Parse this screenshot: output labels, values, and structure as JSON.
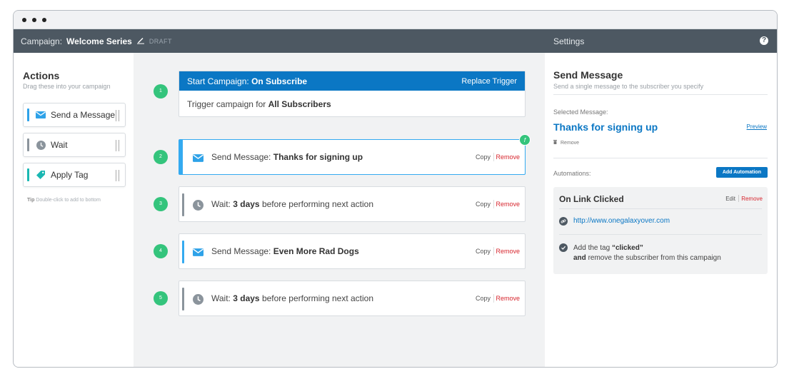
{
  "header": {
    "campaign_label": "Campaign:",
    "campaign_name": "Welcome Series",
    "status": "DRAFT",
    "settings_label": "Settings",
    "help": "?"
  },
  "actions": {
    "title": "Actions",
    "subtitle": "Drag these into your campaign",
    "items": [
      {
        "label": "Send a Message",
        "icon": "envelope-icon",
        "color": "#2ea2e8"
      },
      {
        "label": "Wait",
        "icon": "clock-icon",
        "color": "#8b949c"
      },
      {
        "label": "Apply Tag",
        "icon": "tag-icon",
        "color": "#1ab7b2"
      }
    ],
    "tip_label": "Tip",
    "tip_text": "Double-click to add to bottom"
  },
  "workflow": {
    "trigger": {
      "step": "1",
      "title_prefix": "Start Campaign:",
      "title_value": "On Subscribe",
      "replace_label": "Replace Trigger",
      "body_prefix": "Trigger campaign for",
      "body_value": "All Subscribers"
    },
    "steps": [
      {
        "step": "2",
        "type": "message",
        "prefix": "Send Message:",
        "value": "Thanks for signing up",
        "suffix": ""
      },
      {
        "step": "3",
        "type": "wait",
        "prefix": "Wait:",
        "value": "3 days",
        "suffix": "before performing next action"
      },
      {
        "step": "4",
        "type": "message",
        "prefix": "Send Message:",
        "value": "Even More Rad Dogs",
        "suffix": ""
      },
      {
        "step": "5",
        "type": "wait",
        "prefix": "Wait:",
        "value": "3 days",
        "suffix": "before performing next action"
      }
    ],
    "copy_label": "Copy",
    "remove_label": "Remove",
    "badge": "f"
  },
  "settings": {
    "title": "Send Message",
    "subtitle": "Send a single message to the subscriber you specify",
    "selected_label": "Selected Message:",
    "selected_message": "Thanks for signing up",
    "preview_label": "Preview",
    "remove_label": "Remove",
    "automations_label": "Automations:",
    "add_button": "Add Automation",
    "automation": {
      "title": "On Link Clicked",
      "edit_label": "Edit",
      "remove_label": "Remove",
      "url": "http://www.onegalaxyover.com",
      "action_prefix": "Add the tag",
      "action_tag": "“clicked”",
      "action_and": "and",
      "action_suffix": "remove the subscriber from this campaign"
    }
  },
  "colors": {
    "accent": "#0b77c4",
    "step_green": "#34c47c",
    "remove_red": "#d7262e",
    "topbar": "#4d5862"
  }
}
